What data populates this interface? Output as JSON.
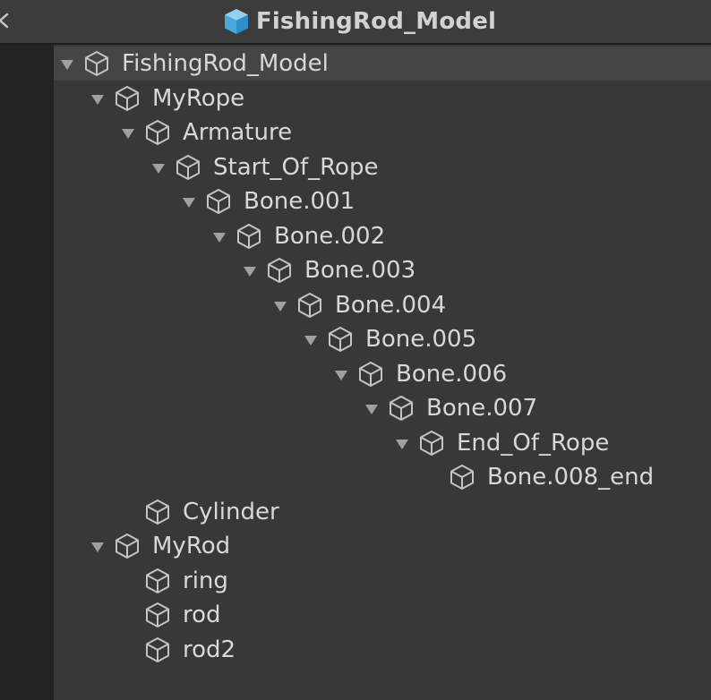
{
  "header": {
    "title": "FishingRod_Model"
  },
  "colors": {
    "header_bg": "#3c3c3c",
    "tree_bg": "#383838",
    "selected_row_bg": "#454545",
    "text": "#d8d8d8",
    "prefab_icon": "#5bb6e6",
    "caret": "#a0a0a0"
  },
  "tree": {
    "items": [
      {
        "label": "FishingRod_Model",
        "expanded": true,
        "icon": "cube-icon"
      },
      {
        "label": "MyRope",
        "expanded": true,
        "icon": "cube-icon"
      },
      {
        "label": "Armature",
        "expanded": true,
        "icon": "cube-icon"
      },
      {
        "label": "Start_Of_Rope",
        "expanded": true,
        "icon": "cube-icon"
      },
      {
        "label": "Bone.001",
        "expanded": true,
        "icon": "cube-icon"
      },
      {
        "label": "Bone.002",
        "expanded": true,
        "icon": "cube-icon"
      },
      {
        "label": "Bone.003",
        "expanded": true,
        "icon": "cube-icon"
      },
      {
        "label": "Bone.004",
        "expanded": true,
        "icon": "cube-icon"
      },
      {
        "label": "Bone.005",
        "expanded": true,
        "icon": "cube-icon"
      },
      {
        "label": "Bone.006",
        "expanded": true,
        "icon": "cube-icon"
      },
      {
        "label": "Bone.007",
        "expanded": true,
        "icon": "cube-icon"
      },
      {
        "label": "End_Of_Rope",
        "expanded": true,
        "icon": "cube-icon"
      },
      {
        "label": "Bone.008_end",
        "expanded": false,
        "icon": "cube-icon"
      },
      {
        "label": "Cylinder",
        "expanded": false,
        "icon": "cube-icon"
      },
      {
        "label": "MyRod",
        "expanded": true,
        "icon": "cube-icon"
      },
      {
        "label": "ring",
        "expanded": false,
        "icon": "cube-icon"
      },
      {
        "label": "rod",
        "expanded": false,
        "icon": "cube-icon"
      },
      {
        "label": "rod2",
        "expanded": false,
        "icon": "cube-icon"
      }
    ]
  }
}
